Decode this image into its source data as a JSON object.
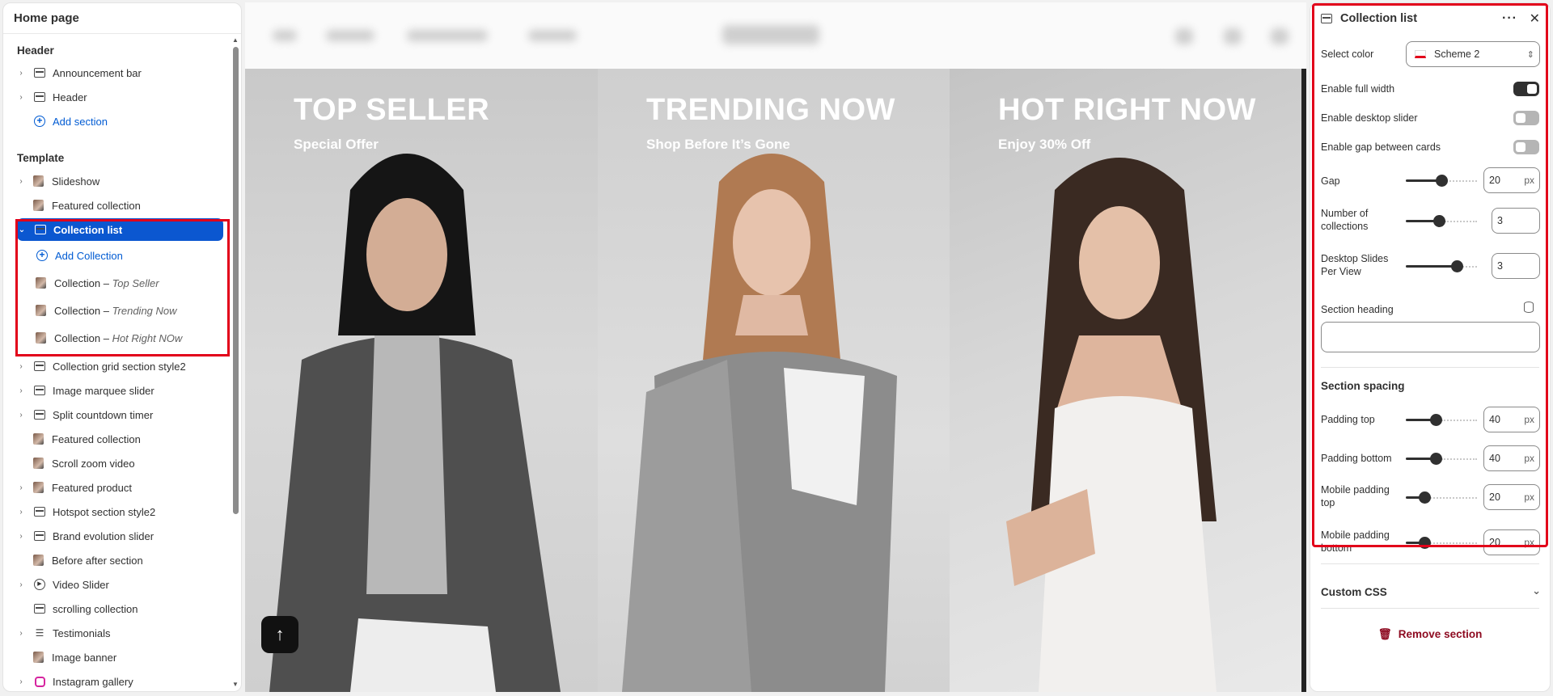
{
  "left_panel": {
    "title": "Home page",
    "header_group": "Header",
    "header_items": [
      "Announcement bar",
      "Header"
    ],
    "add_section": "Add section",
    "template_group": "Template",
    "template_items": [
      "Slideshow",
      "Featured collection",
      "Collection list",
      "Add Collection",
      "Collection grid section style2",
      "Image marquee slider",
      "Split countdown timer",
      "Featured collection",
      "Scroll zoom video",
      "Featured product",
      "Hotspot section style2",
      "Brand evolution slider",
      "Before after section",
      "Video Slider",
      "scrolling collection",
      "Testimonials",
      "Image banner",
      "Instagram gallery"
    ],
    "collections": [
      {
        "prefix": "Collection – ",
        "name": "Top Seller"
      },
      {
        "prefix": "Collection – ",
        "name": "Trending Now"
      },
      {
        "prefix": "Collection – ",
        "name": "Hot Right NOw"
      }
    ]
  },
  "preview": {
    "cards": [
      {
        "title": "TOP SELLER",
        "subtitle": "Special Offer"
      },
      {
        "title": "TRENDING NOW",
        "subtitle": "Shop Before It’s Gone"
      },
      {
        "title": "HOT RIGHT NOW",
        "subtitle": "Enjoy 30% Off"
      }
    ],
    "scroll_top_icon": "arrow-up-icon"
  },
  "right_panel": {
    "title": "Collection list",
    "select_color_label": "Select color",
    "select_color_value": "Scheme 2",
    "enable_full_width": {
      "label": "Enable full width",
      "on": true
    },
    "enable_desktop_slider": {
      "label": "Enable desktop slider",
      "on": false
    },
    "enable_gap": {
      "label": "Enable gap between cards",
      "on": false
    },
    "gap": {
      "label": "Gap",
      "value": "20",
      "unit": "px"
    },
    "num_collections": {
      "label": "Number of collections",
      "value": "3"
    },
    "desktop_slides": {
      "label": "Desktop Slides Per View",
      "value": "3"
    },
    "section_heading_label": "Section heading",
    "section_heading_value": "",
    "section_spacing": "Section spacing",
    "padding_top": {
      "label": "Padding top",
      "value": "40",
      "unit": "px"
    },
    "padding_bottom": {
      "label": "Padding bottom",
      "value": "40",
      "unit": "px"
    },
    "mobile_padding_top": {
      "label": "Mobile padding top",
      "value": "20",
      "unit": "px"
    },
    "mobile_padding_bottom": {
      "label": "Mobile padding bottom",
      "value": "20",
      "unit": "px"
    },
    "custom_css": "Custom CSS",
    "remove_section": "Remove section"
  },
  "colors": {
    "accent": "#0b57d0",
    "highlight": "#e2001a",
    "danger": "#8e0b21"
  }
}
